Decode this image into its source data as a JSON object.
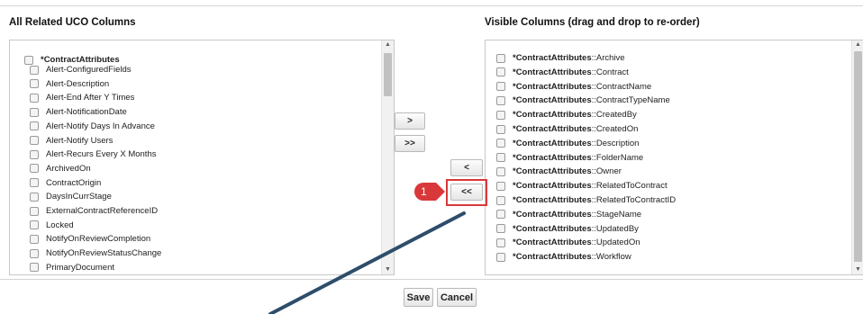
{
  "left_panel": {
    "title": "All Related UCO Columns",
    "group_label": "*ContractAttributes",
    "items": [
      "Alert-ConfiguredFields",
      "Alert-Description",
      "Alert-End After Y Times",
      "Alert-NotificationDate",
      "Alert-Notify Days In Advance",
      "Alert-Notify Users",
      "Alert-Recurs Every X Months",
      "ArchivedOn",
      "ContractOrigin",
      "DaysInCurrStage",
      "ExternalContractReferenceID",
      "Locked",
      "NotifyOnReviewCompletion",
      "NotifyOnReviewStatusChange",
      "PrimaryDocument"
    ]
  },
  "right_panel": {
    "title": "Visible Columns (drag and drop to re-order)",
    "prefix": "*ContractAttributes",
    "separator": "::",
    "items": [
      "Archive",
      "Contract",
      "ContractName",
      "ContractTypeName",
      "CreatedBy",
      "CreatedOn",
      "Description",
      "FolderName",
      "Owner",
      "RelatedToContract",
      "RelatedToContractID",
      "StageName",
      "UpdatedBy",
      "UpdatedOn",
      "Workflow"
    ]
  },
  "transfer_buttons": {
    "move_right": ">",
    "move_all_right": ">>",
    "move_left": "<",
    "move_all_left": "<<"
  },
  "footer": {
    "save_label": "Save",
    "cancel_label": "Cancel"
  },
  "annotation": {
    "badge_number": "1",
    "color": "#d9383a",
    "arrow_color": "#2e4d6b"
  },
  "icons": {
    "scroll_up": "▲",
    "scroll_down": "▼"
  }
}
